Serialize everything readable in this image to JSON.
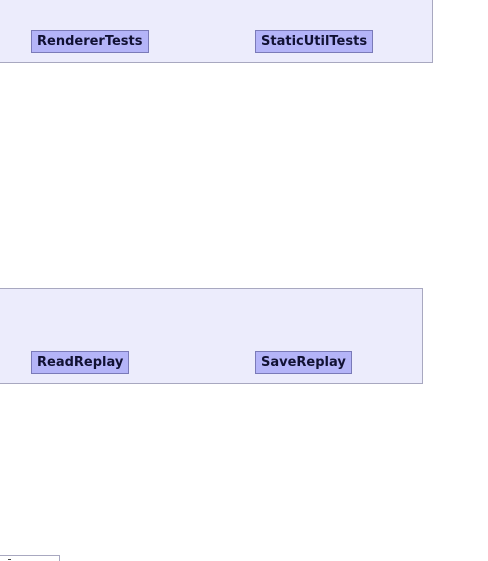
{
  "clusters": {
    "top": {
      "nodes": [
        {
          "label": "RendererTests"
        },
        {
          "label": "StaticUtilTests"
        }
      ]
    },
    "middle": {
      "nodes": [
        {
          "label": "ReadReplay"
        },
        {
          "label": "SaveReplay"
        }
      ]
    }
  },
  "colors": {
    "cluster_fill": "#ececfc",
    "cluster_border": "#a8a8c0",
    "node_fill": "#b4b4f8",
    "node_border": "#7a7ab8",
    "node_text": "#111133"
  }
}
